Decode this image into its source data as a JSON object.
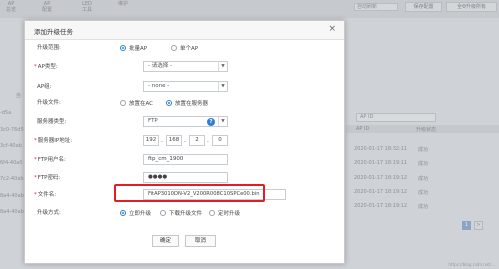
{
  "background": {
    "nav": [
      {
        "top": "AP",
        "label": "总览"
      },
      {
        "top": "AP",
        "label": "配置"
      },
      {
        "top": "LED",
        "label": "工具"
      },
      {
        "top": "",
        "label": "维护"
      }
    ],
    "auto_refresh": "自动刷新",
    "save_config": "保存配置",
    "upgrade_all": "全Φ升级所有",
    "left_label": "自",
    "left_fragments": [
      "-d5a",
      "3c0-76d5",
      "3cf-40ab",
      "6f4-40a0",
      "7c2-40ab",
      "8a4-40ab",
      "8a4-40ab"
    ],
    "ap_id_placeholder": "AP ID",
    "table_headers": [
      "AP ID",
      "升级状态"
    ],
    "rows": [
      {
        "time": "2020-01-17 18:32:11",
        "status": "成功"
      },
      {
        "time": "2020-01-17 18:19:11",
        "status": "成功"
      },
      {
        "time": "2020-01-17 18:19:12",
        "status": "成功"
      },
      {
        "time": "2020-01-17 18:19:12",
        "status": "成功"
      },
      {
        "time": "2020-01-17 18:19:12",
        "status": "成功"
      }
    ],
    "pager": [
      "1",
      ">"
    ],
    "footer": "https://blog.csdn.net/..."
  },
  "modal": {
    "title": "添加升级任务",
    "close_glyph": "×",
    "fields": {
      "scope_label": "升级范围:",
      "scope_options": [
        "批量AP",
        "单个AP"
      ],
      "ap_type_label": "AP类型:",
      "ap_type_value": "- 请选择 -",
      "ap_group_label": "AP组:",
      "ap_group_value": "- none -",
      "upgrade_file_label": "升级文件:",
      "upgrade_file_options": [
        "放置在AC",
        "放置在服务器"
      ],
      "server_type_label": "服务器类型:",
      "server_type_value": "FTP",
      "server_ip_label": "服务器IP地址:",
      "server_ip": [
        "192",
        "168",
        "2",
        "0"
      ],
      "ftp_user_label": "FTP用户名:",
      "ftp_user_value": "ftp_cm_1900",
      "ftp_password_label": "FTP密码:",
      "ftp_password_value": "●●●●",
      "filename_label": "文件名:",
      "filename_value": "FitAP3010DN-V2_V200R008C10SPCe00.bin",
      "method_label": "升级方式:",
      "method_options": [
        "立即升级",
        "下载升级文件",
        "定时升级"
      ]
    },
    "buttons": {
      "confirm": "确定",
      "cancel": "取消"
    },
    "colors": {
      "accent": "#2d7ed8",
      "highlight": "#e11e24",
      "required": "#e0262b"
    }
  }
}
